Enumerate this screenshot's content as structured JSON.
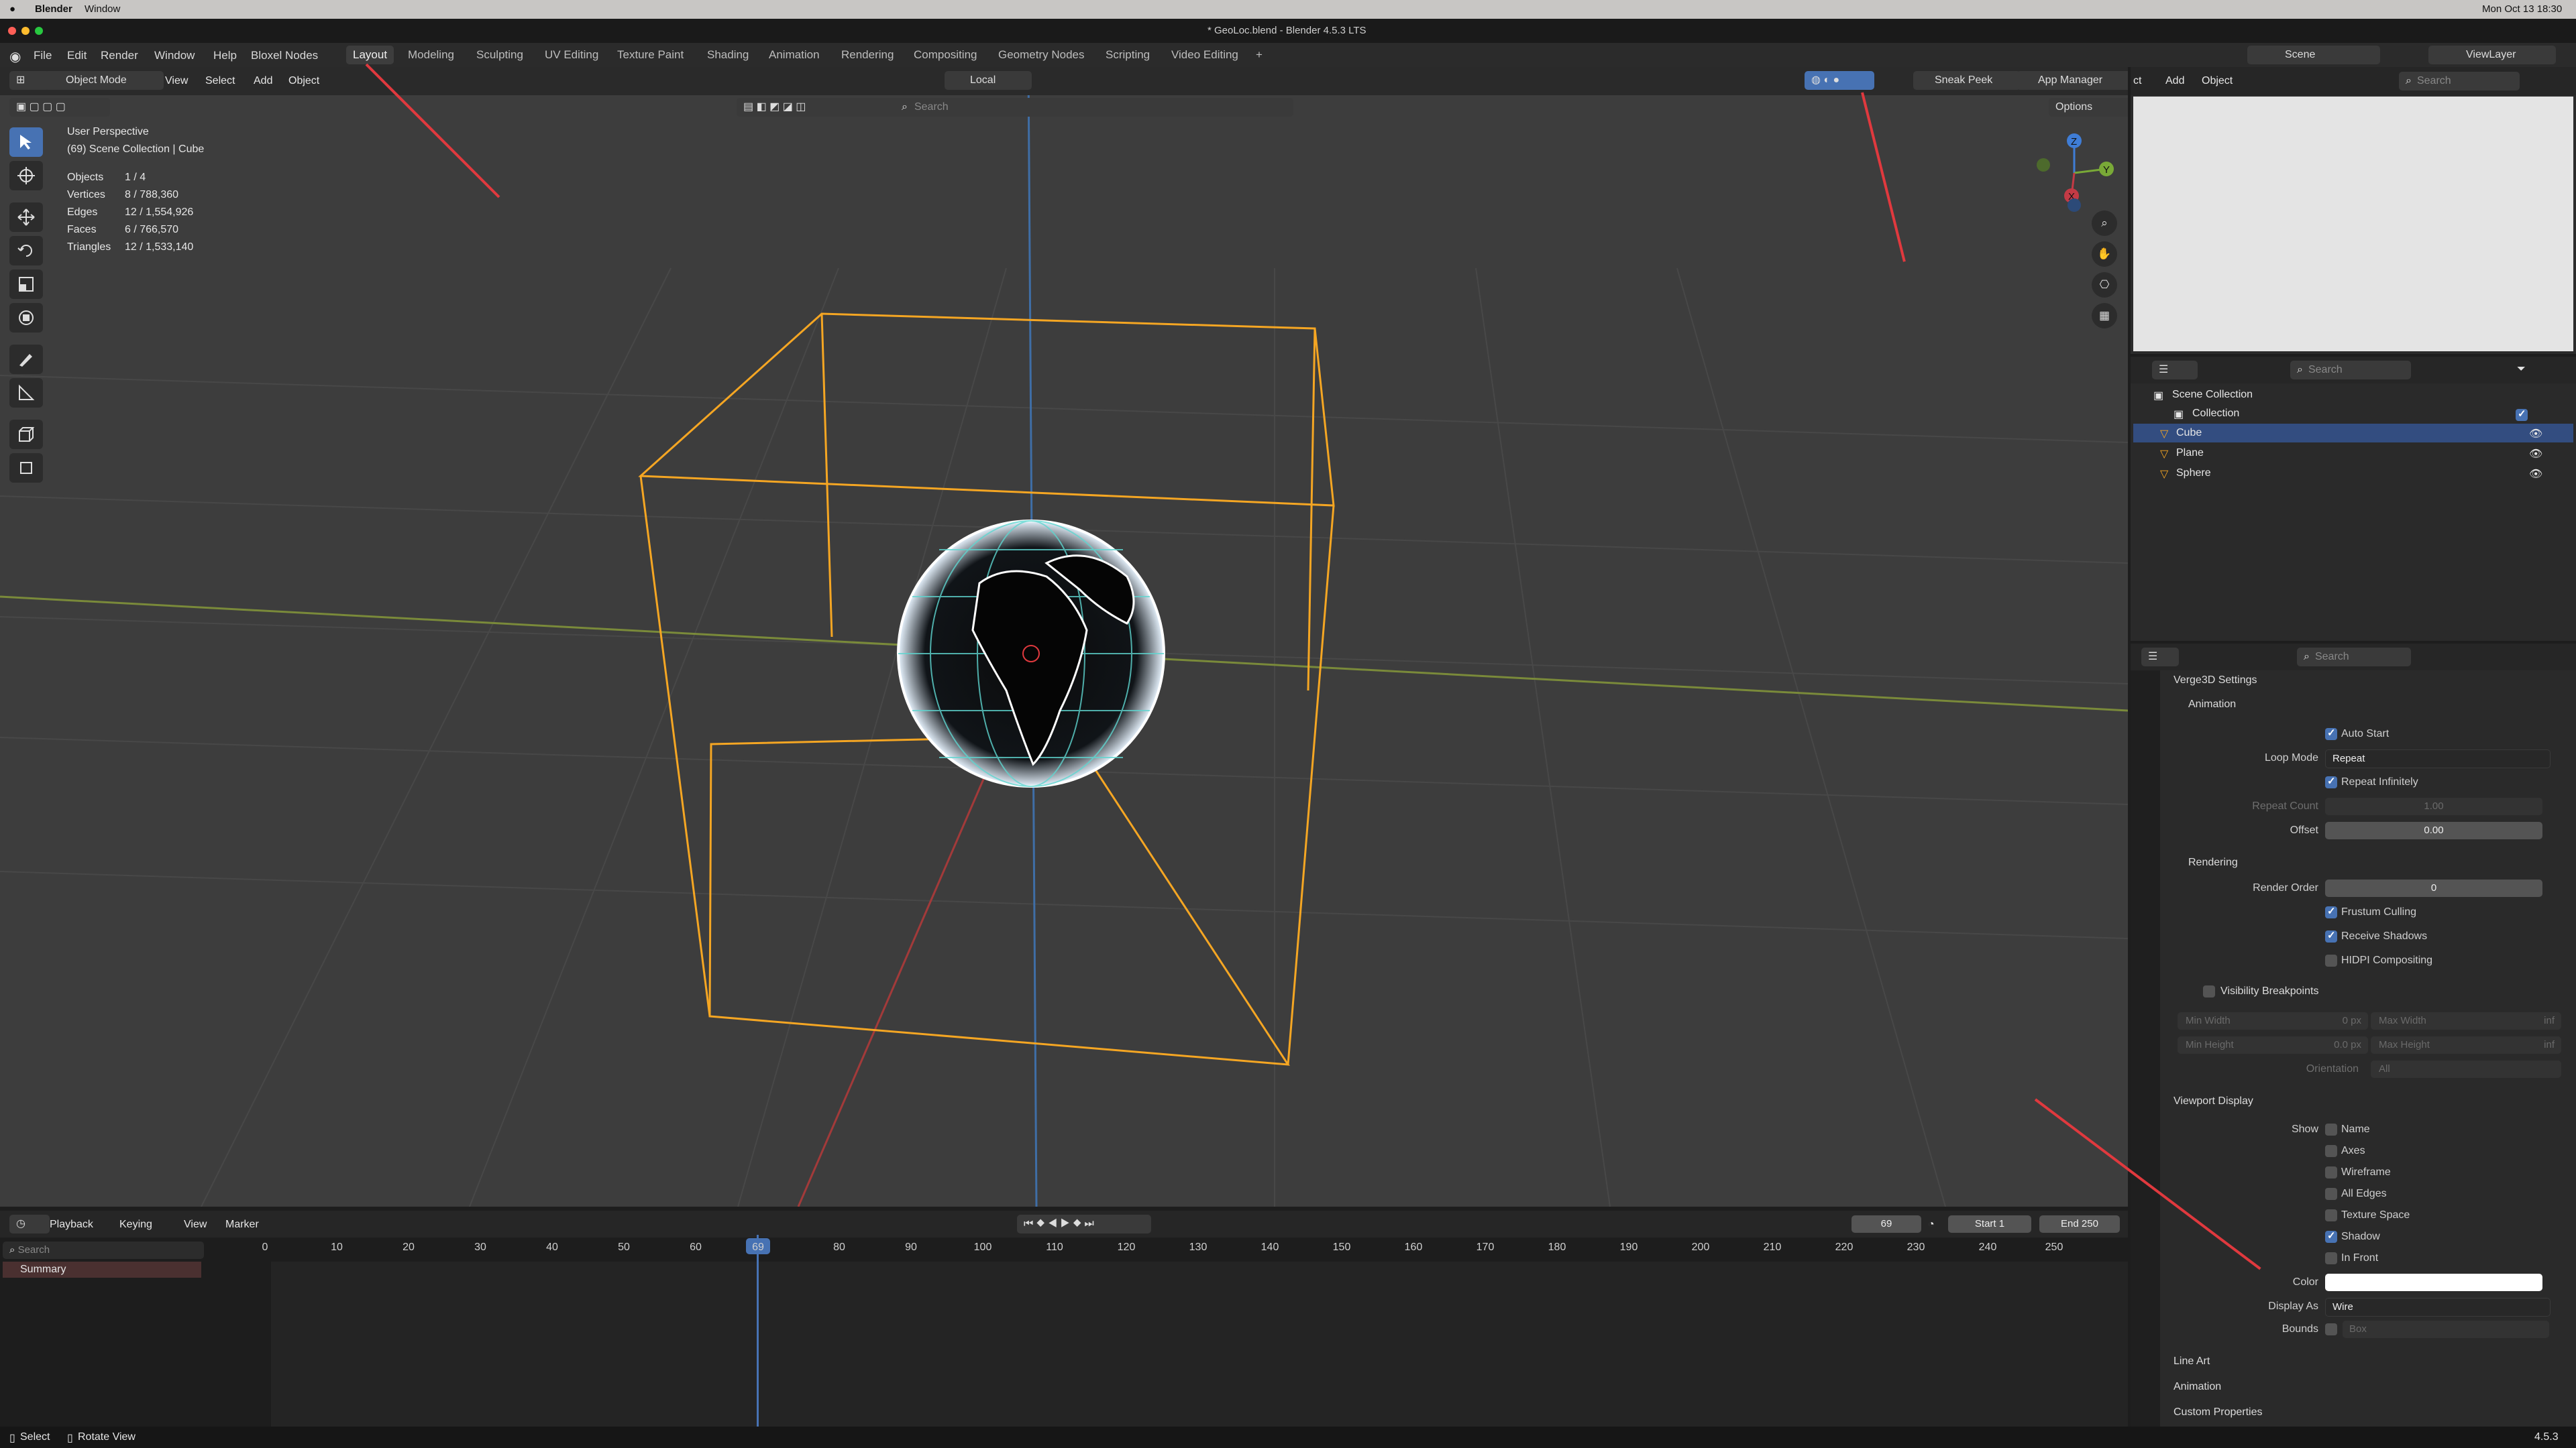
{
  "mac_menu": {
    "app": "Blender",
    "window": "Window",
    "clock": "Mon Oct 13  18:30"
  },
  "title": "* GeoLoc.blend - Blender 4.5.3 LTS",
  "menus": [
    "File",
    "Edit",
    "Render",
    "Window",
    "Help",
    "Bloxel Nodes"
  ],
  "workspaces": [
    "Layout",
    "Modeling",
    "Sculpting",
    "UV Editing",
    "Texture Paint",
    "Shading",
    "Animation",
    "Rendering",
    "Compositing",
    "Geometry Nodes",
    "Scripting",
    "Video Editing"
  ],
  "active_workspace": "Layout",
  "top_right": {
    "scene": "Scene",
    "view_layer": "ViewLayer"
  },
  "viewport_header": {
    "mode": "Object Mode",
    "menus": [
      "View",
      "Select",
      "Add",
      "Object"
    ],
    "transform": "Local",
    "search_placeholder": "Search",
    "sneak_peek": "Sneak Peek",
    "app_manager": "App Manager",
    "options": "Options"
  },
  "overlay_info": {
    "view_name": "User Perspective",
    "collection": "(69) Scene Collection | Cube",
    "stats": [
      {
        "label": "Objects",
        "value": "1 / 4"
      },
      {
        "label": "Vertices",
        "value": "8 / 788,360"
      },
      {
        "label": "Edges",
        "value": "12 / 1,554,926"
      },
      {
        "label": "Faces",
        "value": "6 / 766,570"
      },
      {
        "label": "Triangles",
        "value": "12 / 1,533,140"
      }
    ]
  },
  "gizmo": {
    "x": "X",
    "y": "Y",
    "z": "Z"
  },
  "right_header": {
    "menus": [
      "ct",
      "Add",
      "Object"
    ],
    "search_placeholder": "Search"
  },
  "outliner": {
    "search_placeholder": "Search",
    "root": "Scene Collection",
    "collection": "Collection",
    "items": [
      {
        "name": "Cube",
        "selected": true
      },
      {
        "name": "Plane",
        "selected": false
      },
      {
        "name": "Sphere",
        "selected": false
      }
    ]
  },
  "properties": {
    "search_placeholder": "Search",
    "verge3d": "Verge3D Settings",
    "animation_section": "Animation",
    "auto_start": "Auto Start",
    "loop_mode_label": "Loop Mode",
    "loop_mode_value": "Repeat",
    "repeat_infinitely": "Repeat Infinitely",
    "repeat_count_label": "Repeat Count",
    "repeat_count_value": "1.00",
    "offset_label": "Offset",
    "offset_value": "0.00",
    "rendering_section": "Rendering",
    "render_order_label": "Render Order",
    "render_order_value": "0",
    "frustum_culling": "Frustum Culling",
    "receive_shadows": "Receive Shadows",
    "hidpi": "HIDPI Compositing",
    "visibility_section": "Visibility Breakpoints",
    "min_width_label": "Min Width",
    "min_width_value": "0 px",
    "max_width_label": "Max Width",
    "max_width_value": "inf",
    "min_height_label": "Min Height",
    "min_height_value": "0.0 px",
    "max_height_label": "Max Height",
    "max_height_value": "inf",
    "orientation_label": "Orientation",
    "orientation_value": "All",
    "viewport_display": "Viewport Display",
    "show_label": "Show",
    "show_items": [
      {
        "name": "Name",
        "on": false
      },
      {
        "name": "Axes",
        "on": false
      },
      {
        "name": "Wireframe",
        "on": false
      },
      {
        "name": "All Edges",
        "on": false
      },
      {
        "name": "Texture Space",
        "on": false
      },
      {
        "name": "Shadow",
        "on": true
      },
      {
        "name": "In Front",
        "on": false
      }
    ],
    "color_label": "Color",
    "display_as_label": "Display As",
    "display_as_value": "Wire",
    "bounds_label": "Bounds",
    "bounds_value": "Box",
    "collapsed": [
      "Line Art",
      "Animation",
      "Custom Properties"
    ]
  },
  "timeline": {
    "menus": [
      "Playback",
      "Keying",
      "View",
      "Marker"
    ],
    "current_frame": "69",
    "start_label": "Start",
    "start": "1",
    "end_label": "End",
    "end": "250",
    "search_placeholder": "Search",
    "summary": "Summary",
    "ticks": [
      "0",
      "10",
      "20",
      "30",
      "40",
      "50",
      "60",
      "69",
      "80",
      "90",
      "100",
      "110",
      "120",
      "130",
      "140",
      "150",
      "160",
      "170",
      "180",
      "190",
      "200",
      "210",
      "220",
      "230",
      "240",
      "250"
    ]
  },
  "status": {
    "select": "Select",
    "rotate": "Rotate View",
    "version": "4.5.3"
  },
  "colors": {
    "accent": "#4772b3",
    "selection": "#f5a623",
    "annotation": "#e0393e"
  }
}
